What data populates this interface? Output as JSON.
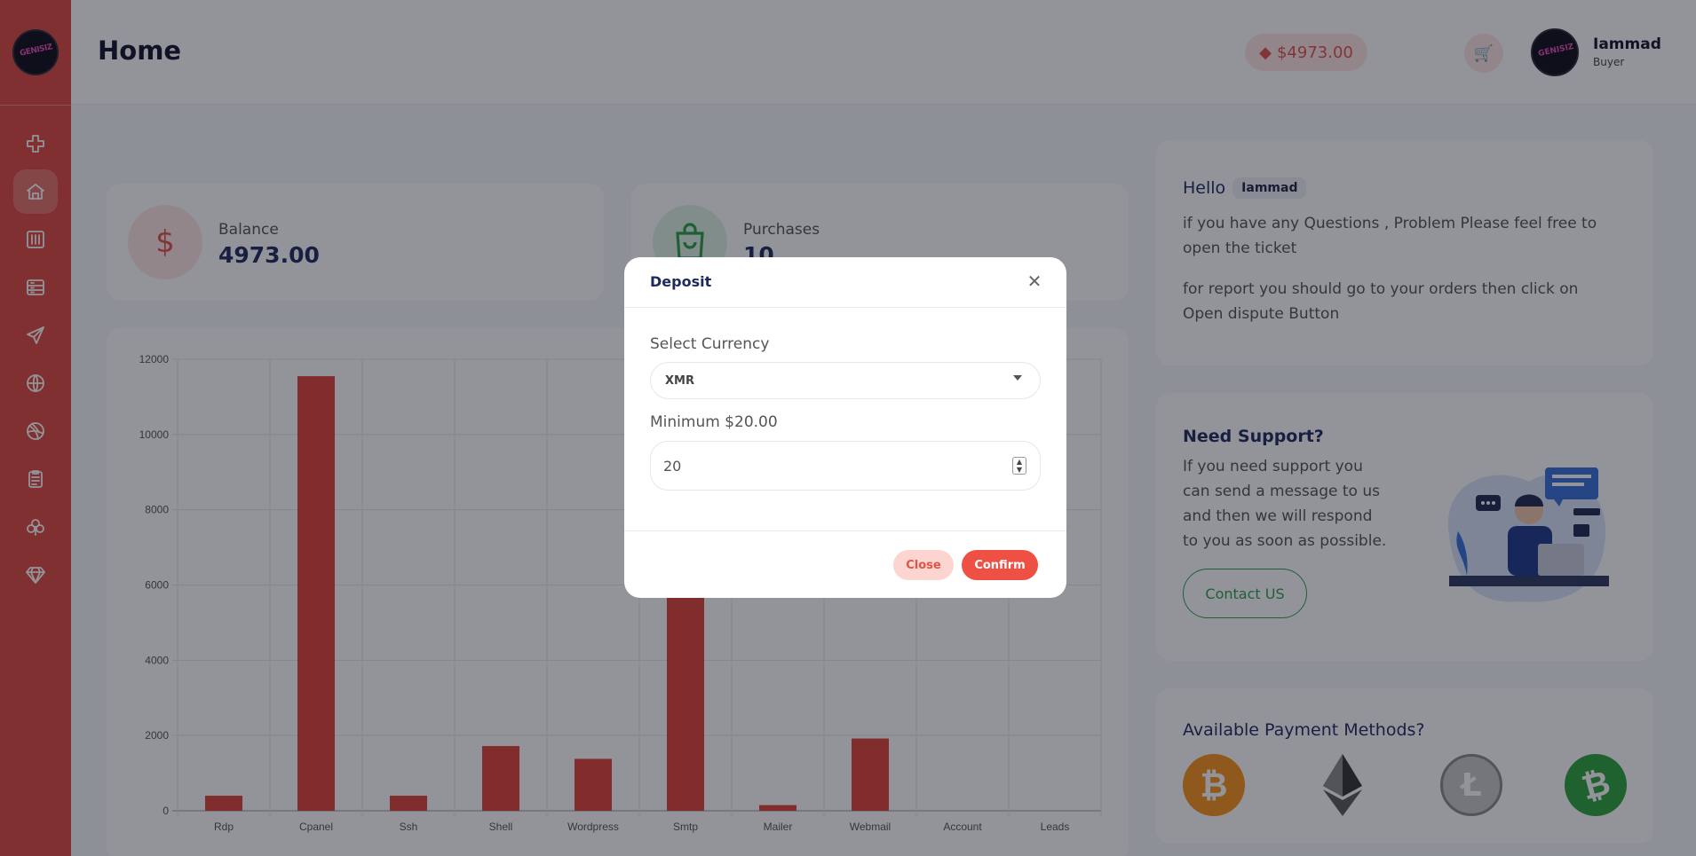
{
  "sidebar": {
    "logo_text": "GENISIZ",
    "items": [
      {
        "icon": "plus-cross-icon"
      },
      {
        "icon": "home-icon",
        "active": true
      },
      {
        "icon": "sliders-icon"
      },
      {
        "icon": "server-icon"
      },
      {
        "icon": "send-icon"
      },
      {
        "icon": "globe-icon"
      },
      {
        "icon": "dribbble-icon"
      },
      {
        "icon": "clipboard-icon"
      },
      {
        "icon": "tree-icon"
      },
      {
        "icon": "diamond-icon"
      }
    ]
  },
  "header": {
    "title": "Home",
    "balance": "$4973.00",
    "user_name": "Iammad",
    "user_role": "Buyer"
  },
  "stats": {
    "balance": {
      "label": "Balance",
      "value": "4973.00"
    },
    "purchases": {
      "label": "Purchases",
      "value": "10"
    }
  },
  "chart_data": {
    "type": "bar",
    "categories": [
      "Rdp",
      "Cpanel",
      "Ssh",
      "Shell",
      "Wordpress",
      "Smtp",
      "Mailer",
      "Webmail",
      "Account",
      "Leads"
    ],
    "values": [
      400,
      11550,
      400,
      1720,
      1380,
      5800,
      150,
      1920,
      0,
      0
    ],
    "ylim": [
      0,
      12000
    ],
    "yticks": [
      0,
      2000,
      4000,
      6000,
      8000,
      10000,
      12000
    ],
    "grid": true,
    "color": "#e0443a"
  },
  "hello": {
    "title": "Hello",
    "name": "Iammad",
    "line1": "if you have any Questions , Problem Please feel free to open the ticket",
    "line2": "for report you should go to your orders then click on Open dispute Button"
  },
  "support": {
    "title": "Need Support?",
    "text": "If you need support you can send a message to us and then we will respond to you as soon as possible.",
    "button": "Contact US"
  },
  "payment": {
    "title": "Available Payment Methods?",
    "methods": [
      "bitcoin-icon",
      "ethereum-icon",
      "litecoin-icon",
      "bitcoin-cash-icon"
    ]
  },
  "modal": {
    "title": "Deposit",
    "currency_label": "Select Currency",
    "currency_value": "XMR",
    "min_label": "Minimum $20.00",
    "amount_value": "20",
    "close_label": "Close",
    "confirm_label": "Confirm"
  },
  "colors": {
    "primary": "#dc4a3f",
    "accent": "#ee5144",
    "green": "#2e9e4a"
  }
}
